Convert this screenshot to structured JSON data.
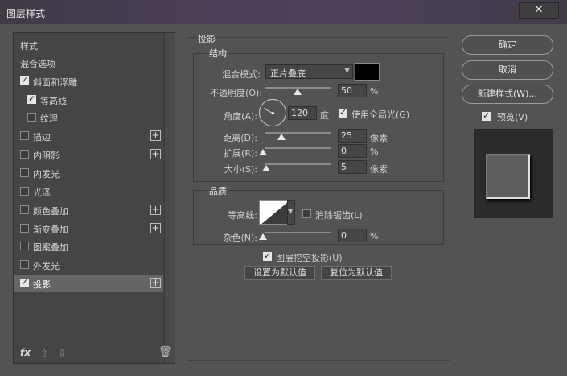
{
  "window": {
    "title": "图层样式",
    "close_glyph": "✕"
  },
  "styles_list": {
    "header_label": "样式",
    "blend_options_label": "混合选项",
    "items": [
      {
        "label": "斜面和浮雕",
        "checked": true
      },
      {
        "label": "等高线",
        "checked": true
      },
      {
        "label": "纹理",
        "checked": false
      },
      {
        "label": "描边",
        "checked": false
      },
      {
        "label": "内阴影",
        "checked": false
      },
      {
        "label": "内发光",
        "checked": false
      },
      {
        "label": "光泽",
        "checked": false
      },
      {
        "label": "颜色叠加",
        "checked": false
      },
      {
        "label": "渐变叠加",
        "checked": false
      },
      {
        "label": "图案叠加",
        "checked": false
      },
      {
        "label": "外发光",
        "checked": false
      },
      {
        "label": "投影",
        "checked": true
      }
    ],
    "footer": {
      "fx_label": "fx",
      "up_icon": "arrow-up-icon",
      "down_icon": "arrow-down-icon",
      "trash_icon": "trash-icon"
    }
  },
  "drop_shadow": {
    "section_title": "投影",
    "structure": {
      "title": "结构",
      "blend_mode_label": "混合模式:",
      "blend_mode_value": "正片叠底",
      "swatch_color": "#000000",
      "opacity_label": "不透明度(O):",
      "opacity_value": "50",
      "opacity_unit": "%",
      "angle_label": "角度(A):",
      "angle_value": "120",
      "angle_unit": "度",
      "global_light_label": "使用全局光(G)",
      "global_light_checked": true,
      "distance_label": "距离(D):",
      "distance_value": "25",
      "distance_unit": "像素",
      "spread_label": "扩展(R):",
      "spread_value": "0",
      "spread_unit": "%",
      "size_label": "大小(S):",
      "size_value": "5",
      "size_unit": "像素"
    },
    "quality": {
      "title": "品质",
      "contour_label": "等高线:",
      "anti_alias_label": "消除锯齿(L)",
      "anti_alias_checked": false,
      "noise_label": "杂色(N):",
      "noise_value": "0",
      "noise_unit": "%"
    },
    "knockout_label": "图层挖空投影(U)",
    "knockout_checked": true,
    "make_default_label": "设置为默认值",
    "reset_default_label": "复位为默认值"
  },
  "actions": {
    "ok_label": "确定",
    "cancel_label": "取消",
    "new_style_label": "新建样式(W)...",
    "preview_label": "预览(V)",
    "preview_checked": true
  }
}
